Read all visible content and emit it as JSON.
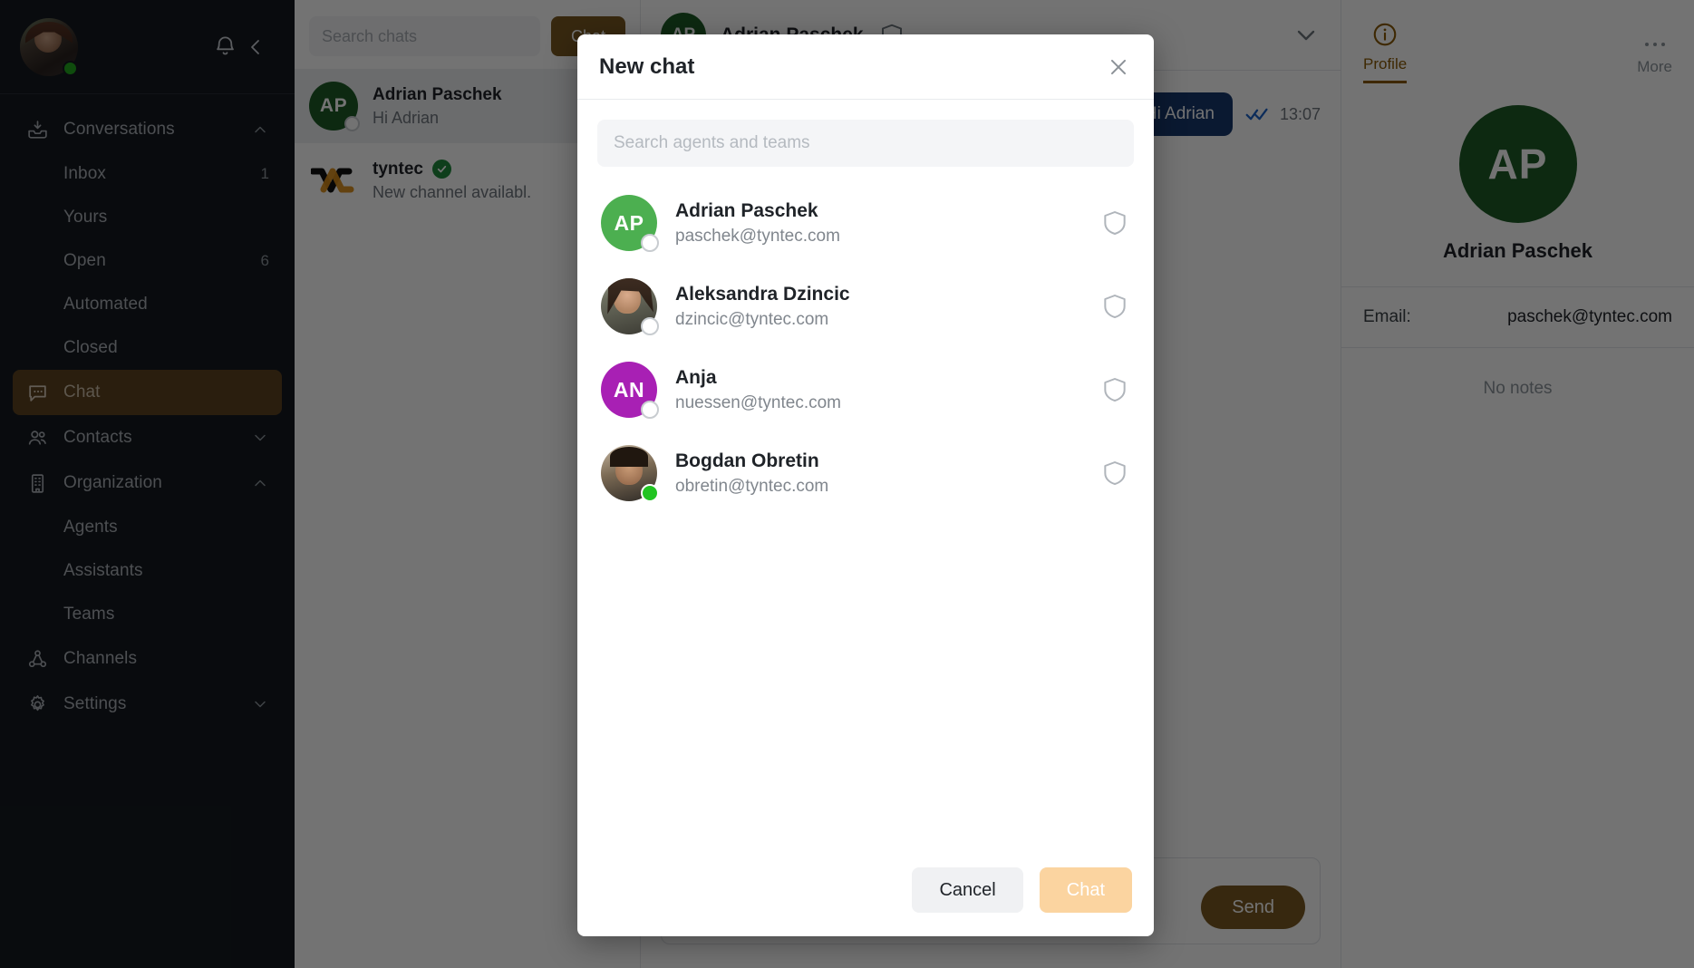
{
  "sidebar": {
    "user": {
      "status": "online"
    },
    "icons": {
      "bell": "bell-icon",
      "collapse": "chevron-left-icon"
    },
    "groups": [
      {
        "label": "Conversations",
        "icon": "inbox-tray-icon",
        "expanded": true,
        "chevron": "chevron-up"
      },
      {
        "label": "Inbox",
        "sub": true,
        "badge": "1"
      },
      {
        "label": "Yours",
        "sub": true,
        "badge": ""
      },
      {
        "label": "Open",
        "sub": true,
        "badge": "6"
      },
      {
        "label": "Automated",
        "sub": true,
        "badge": ""
      },
      {
        "label": "Closed",
        "sub": true,
        "badge": ""
      },
      {
        "label": "Chat",
        "icon": "chat-bubble-icon",
        "active": true
      },
      {
        "label": "Contacts",
        "icon": "people-icon",
        "chevron": "chevron-down"
      },
      {
        "label": "Organization",
        "icon": "building-icon",
        "chevron": "chevron-up"
      },
      {
        "label": "Agents",
        "sub": true,
        "badge": ""
      },
      {
        "label": "Assistants",
        "sub": true,
        "badge": ""
      },
      {
        "label": "Teams",
        "sub": true,
        "badge": ""
      },
      {
        "label": "Channels",
        "icon": "share-nodes-icon",
        "chevron": ""
      },
      {
        "label": "Settings",
        "icon": "gear-icon",
        "chevron": "chevron-down"
      }
    ]
  },
  "chat_list": {
    "search_placeholder": "Search chats",
    "new_chat_button": "Chat",
    "items": [
      {
        "name": "Adrian Paschek",
        "preview": "Hi Adrian",
        "initials": "AP",
        "avatar_color": "#1d5c27",
        "status": "offline",
        "selected": true,
        "verified": false
      },
      {
        "name": "tyntec",
        "preview": "New channel availabl.",
        "initials": "",
        "avatar_color": "",
        "status": "none",
        "selected": false,
        "verified": true,
        "logo": "tyntec-logo"
      }
    ]
  },
  "conversation": {
    "header": {
      "name": "Adrian Paschek",
      "initials": "AP",
      "avatar_color": "#1d5c27",
      "shield_icon": "shield-icon",
      "chevron_icon": "chevron-down-icon"
    },
    "messages": [
      {
        "text": "Hi Adrian",
        "time": "13:07",
        "status": "read",
        "outgoing": true
      }
    ],
    "composer": {
      "send_label": "Send",
      "placeholder": ""
    }
  },
  "profile_panel": {
    "tabs": [
      {
        "label": "Profile",
        "icon": "info-circle-icon",
        "active": true
      },
      {
        "label": "More",
        "icon": "ellipsis-icon",
        "active": false
      }
    ],
    "initials": "AP",
    "avatar_color": "#1d5c27",
    "name": "Adrian Paschek",
    "fields": [
      {
        "label": "Email:",
        "value": "paschek@tyntec.com"
      }
    ],
    "notes_empty": "No notes"
  },
  "modal": {
    "title": "New chat",
    "close_icon": "close-icon",
    "search_placeholder": "Search agents and teams",
    "search_value": "",
    "people": [
      {
        "name": "Adrian Paschek",
        "email": "paschek@tyntec.com",
        "initials": "AP",
        "avatar_color": "#4caf50",
        "avatar_type": "initials",
        "status": "offline",
        "shield_icon": "shield-icon"
      },
      {
        "name": "Aleksandra Dzincic",
        "email": "dzincic@tyntec.com",
        "initials": "",
        "avatar_color": "",
        "avatar_type": "photo-a",
        "status": "offline",
        "shield_icon": "shield-icon"
      },
      {
        "name": "Anja",
        "email": "nuessen@tyntec.com",
        "initials": "AN",
        "avatar_color": "#a820b4",
        "avatar_type": "initials",
        "status": "offline",
        "shield_icon": "shield-icon"
      },
      {
        "name": "Bogdan Obretin",
        "email": "obretin@tyntec.com",
        "initials": "",
        "avatar_color": "",
        "avatar_type": "photo-b",
        "status": "online",
        "shield_icon": "shield-icon"
      }
    ],
    "cancel_label": "Cancel",
    "confirm_label": "Chat",
    "confirm_disabled": true
  },
  "colors": {
    "brand_brown": "#7a5a22",
    "accent_orange": "#8a5a06",
    "disabled_orange": "#fbd4a0",
    "online_green": "#22c422",
    "avatar_green_dark": "#1d5c27",
    "bubble_blue": "#17386e",
    "tick_blue": "#1b63c7"
  }
}
